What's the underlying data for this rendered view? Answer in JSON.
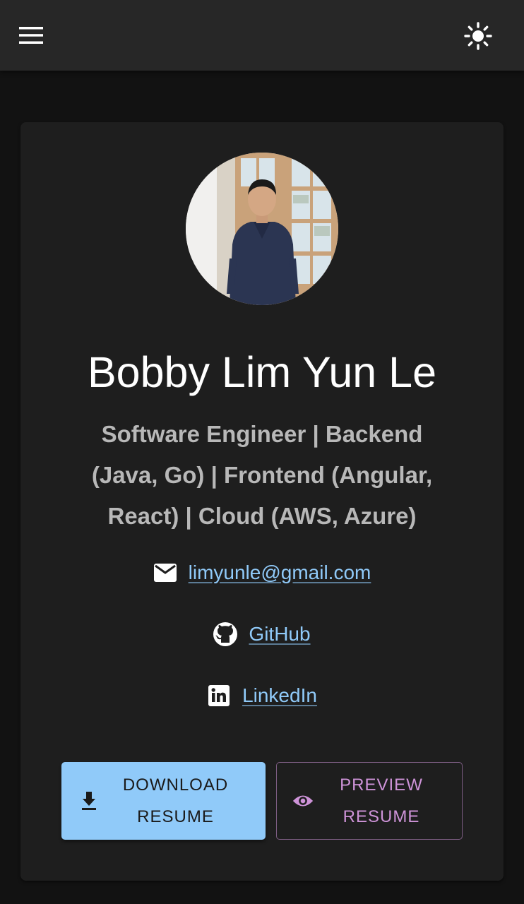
{
  "header": {
    "menu_icon": "menu-icon",
    "theme_icon": "light-mode-sun-icon"
  },
  "profile": {
    "avatar_alt": "profile photo",
    "name": "Bobby Lim Yun Le",
    "headline": "Software Engineer | Backend (Java, Go) | Frontend (Angular, React) | Cloud (AWS, Azure)"
  },
  "contacts": [
    {
      "icon": "email-icon",
      "label": "limyunle@gmail.com"
    },
    {
      "icon": "github-icon",
      "label": "GitHub"
    },
    {
      "icon": "linkedin-icon",
      "label": "LinkedIn"
    }
  ],
  "actions": {
    "download_line1": "DOWNLOAD",
    "download_line2": "RESUME",
    "download_icon": "download-icon",
    "preview_line1": "PREVIEW",
    "preview_line2": "RESUME",
    "preview_icon": "eye-icon"
  },
  "colors": {
    "background": "#121212",
    "appbar": "#272727",
    "card": "#1e1e1e",
    "primary": "#90caf9",
    "secondary": "#ce93d8",
    "link": "#90caf9"
  }
}
